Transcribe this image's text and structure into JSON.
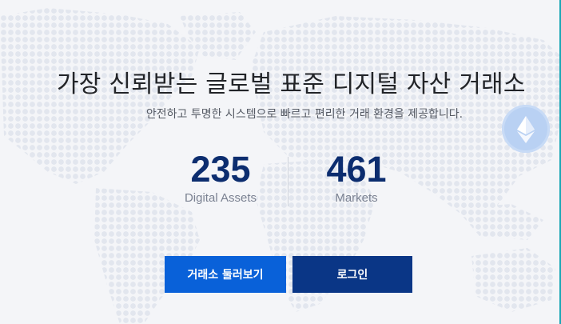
{
  "hero": {
    "title": "가장 신뢰받는 글로벌 표준 디지털 자산 거래소",
    "subtitle": "안전하고 투명한 시스템으로 빠르고 편리한 거래 환경을 제공합니다."
  },
  "stats": [
    {
      "value": "235",
      "label": "Digital Assets"
    },
    {
      "value": "461",
      "label": "Markets"
    }
  ],
  "buttons": {
    "explore": "거래소 둘러보기",
    "login": "로그인"
  },
  "icons": {
    "coin": "ethereum-icon"
  },
  "colors": {
    "background": "#f4f5f8",
    "title": "#222428",
    "stat_value": "#0c2d6f",
    "primary_button": "#0961d9",
    "secondary_button": "#0a3686",
    "accent": "#1aa7b5"
  }
}
